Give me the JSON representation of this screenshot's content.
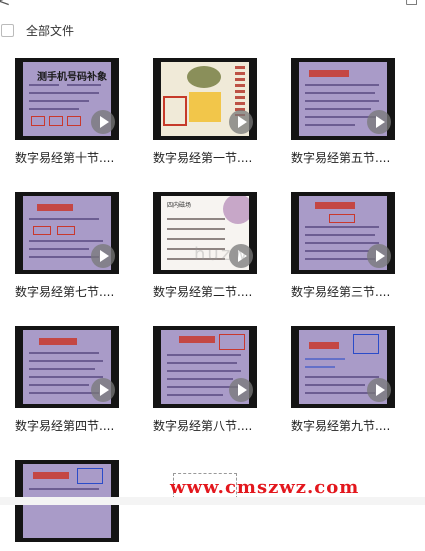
{
  "header": {
    "back_glyph": "<",
    "right_glyph": "□"
  },
  "select_all": {
    "label": "全部文件",
    "checked": false
  },
  "files": [
    {
      "name": "数字易经第十节....",
      "slide_title": "测手机号码补象"
    },
    {
      "name": "数字易经第一节...."
    },
    {
      "name": "数字易经第五节...."
    },
    {
      "name": "数字易经第七节...."
    },
    {
      "name": "数字易经第二节....",
      "slide_subtitle": "四内磁场"
    },
    {
      "name": "数字易经第三节...."
    },
    {
      "name": "数字易经第四节...."
    },
    {
      "name": "数字易经第八节...."
    },
    {
      "name": "数字易经第九节...."
    },
    {
      "name": ""
    }
  ],
  "watermark_center": "huzw",
  "watermark_bottom": "www.cmszwz.com",
  "colors": {
    "slide": "#a99bc8",
    "thumb_bg": "#141414",
    "watermark": "#e3171d"
  },
  "icons": [
    "back-arrow-icon",
    "checkbox-icon",
    "play-icon"
  ]
}
